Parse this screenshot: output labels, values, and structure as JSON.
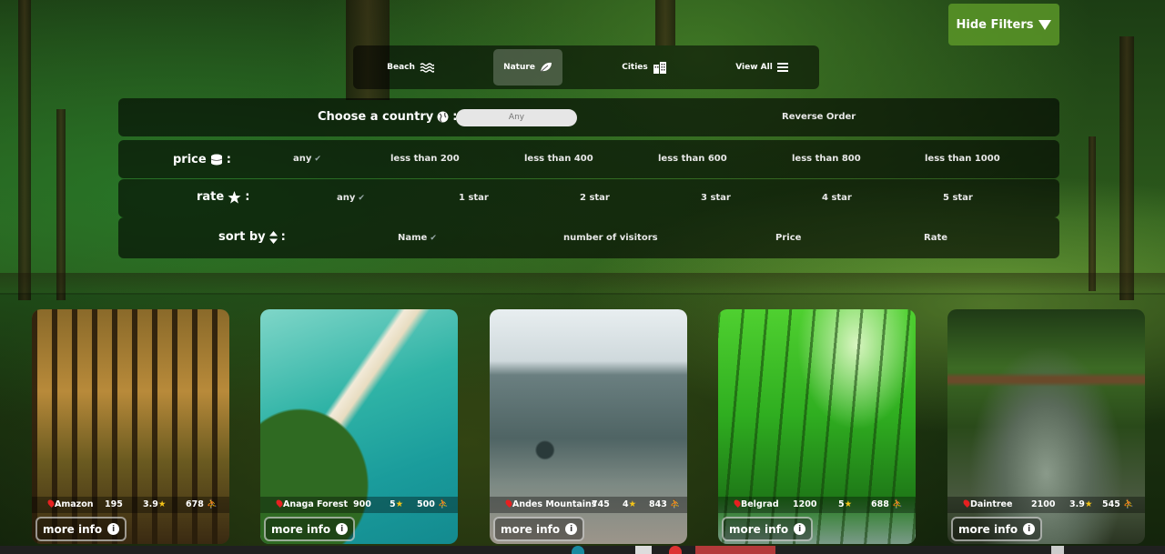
{
  "header": {
    "hide_filters_label": "Hide Filters"
  },
  "categories": [
    {
      "label": "Beach",
      "icon": "waves-icon",
      "active": false
    },
    {
      "label": "Nature",
      "icon": "leaf-icon",
      "active": true
    },
    {
      "label": "Cities",
      "icon": "city-icon",
      "active": false
    },
    {
      "label": "View All",
      "icon": "list-icon",
      "active": false
    }
  ],
  "filters": {
    "country": {
      "label": "Choose a country",
      "placeholder": "Any",
      "reverse_label": "Reverse Order"
    },
    "price": {
      "label": "price",
      "options": [
        "any",
        "less than 200",
        "less than 400",
        "less than 600",
        "less than 800",
        "less than 1000"
      ]
    },
    "rate": {
      "label": "rate",
      "options": [
        "any",
        "1 star",
        "2 star",
        "3 star",
        "4 star",
        "5 star"
      ]
    },
    "sort": {
      "label": "sort by",
      "options": [
        "Name",
        "number of visitors",
        "Price",
        "Rate"
      ]
    }
  },
  "cards": [
    {
      "name": "Amazon",
      "visitors": "195",
      "rating": "3.9",
      "count": "678",
      "more": "more info"
    },
    {
      "name": "Anaga Forest",
      "visitors": "900",
      "rating": "5",
      "count": "500",
      "more": "more info"
    },
    {
      "name": "Andes Mountains",
      "visitors": "745",
      "rating": "4",
      "count": "843",
      "more": "more info"
    },
    {
      "name": "Belgrad",
      "visitors": "1200",
      "rating": "5",
      "count": "688",
      "more": "more info"
    },
    {
      "name": "Daintree",
      "visitors": "2100",
      "rating": "3.9",
      "count": "545",
      "more": "more info"
    }
  ],
  "colors": {
    "accent": "#5a9628",
    "star": "#f5c518",
    "pin": "#e62020"
  }
}
